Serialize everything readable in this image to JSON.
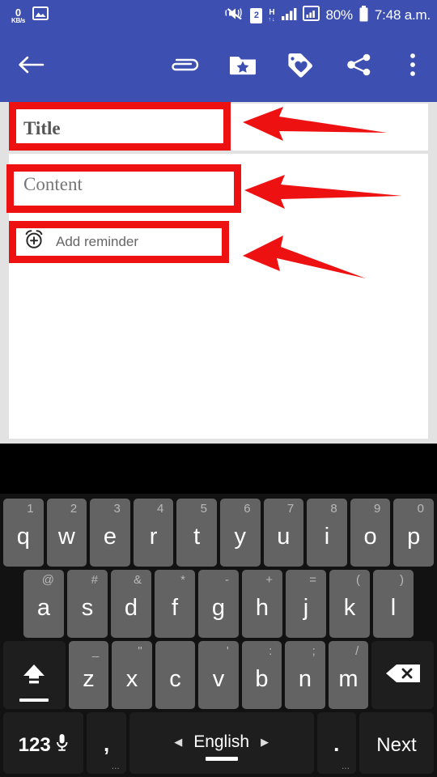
{
  "status_bar": {
    "net_speed_value": "0",
    "net_speed_unit": "KB/s",
    "gallery_icon": "image-icon",
    "mute_icon": "vibrate-mute-icon",
    "sim_label": "2",
    "network_type": "H",
    "network_arrows": "↑↓",
    "signal_icon_1": "signal-bars-icon",
    "signal_icon_2": "signal-bars-boxed-icon",
    "battery_percent": "80%",
    "battery_icon": "battery-icon",
    "time": "7:48 a.m.",
    "background_color": "#3d4fb0"
  },
  "toolbar": {
    "background_color": "#3d4fb0",
    "back_icon": "back-arrow-icon",
    "attach_icon": "paperclip-icon",
    "favorite_folder_icon": "folder-star-icon",
    "tag_icon": "tag-heart-icon",
    "share_icon": "share-icon",
    "overflow_icon": "overflow-menu-icon"
  },
  "note_form": {
    "title_placeholder": "Title",
    "content_placeholder": "Content",
    "reminder_label": "Add reminder",
    "reminder_icon": "alarm-clock-plus-icon",
    "card_background": "#ffffff",
    "page_background": "#e2e2e2"
  },
  "annotations": {
    "highlight_color": "#ee1111",
    "boxes": [
      {
        "target": "Title"
      },
      {
        "target": "Content"
      },
      {
        "target": "Add reminder"
      }
    ],
    "arrows": [
      {
        "direction": "left",
        "points_to": "Title"
      },
      {
        "direction": "left",
        "points_to": "Content"
      },
      {
        "direction": "left",
        "points_to": "Add reminder"
      }
    ]
  },
  "keyboard": {
    "background_color": "#121212",
    "key_color": "#636363",
    "function_key_color": "#1e1e1e",
    "suggestion_strip_color": "#000000",
    "row1": [
      {
        "main": "q",
        "alt": "1"
      },
      {
        "main": "w",
        "alt": "2"
      },
      {
        "main": "e",
        "alt": "3"
      },
      {
        "main": "r",
        "alt": "4"
      },
      {
        "main": "t",
        "alt": "5"
      },
      {
        "main": "y",
        "alt": "6"
      },
      {
        "main": "u",
        "alt": "7"
      },
      {
        "main": "i",
        "alt": "8"
      },
      {
        "main": "o",
        "alt": "9"
      },
      {
        "main": "p",
        "alt": "0"
      }
    ],
    "row2": [
      {
        "main": "a",
        "alt": "@"
      },
      {
        "main": "s",
        "alt": "#"
      },
      {
        "main": "d",
        "alt": "&"
      },
      {
        "main": "f",
        "alt": "*"
      },
      {
        "main": "g",
        "alt": "-"
      },
      {
        "main": "h",
        "alt": "+"
      },
      {
        "main": "j",
        "alt": "="
      },
      {
        "main": "k",
        "alt": "("
      },
      {
        "main": "l",
        "alt": ")"
      }
    ],
    "row3": [
      {
        "main": "z",
        "alt": "_"
      },
      {
        "main": "x",
        "alt": "\""
      },
      {
        "main": "c",
        "alt": ""
      },
      {
        "main": "v",
        "alt": "'"
      },
      {
        "main": "b",
        "alt": ":"
      },
      {
        "main": "n",
        "alt": ";"
      },
      {
        "main": "m",
        "alt": "/"
      }
    ],
    "shift_icon": "shift-arrow-icon",
    "backspace_icon": "backspace-icon",
    "numeric_label": "123",
    "mic_icon": "microphone-icon",
    "comma_label": ",",
    "comma_more": "...",
    "space_language": "English",
    "space_prev_icon": "◀",
    "space_next_icon": "▶",
    "period_label": ".",
    "period_more": "...",
    "enter_label": "Next"
  }
}
